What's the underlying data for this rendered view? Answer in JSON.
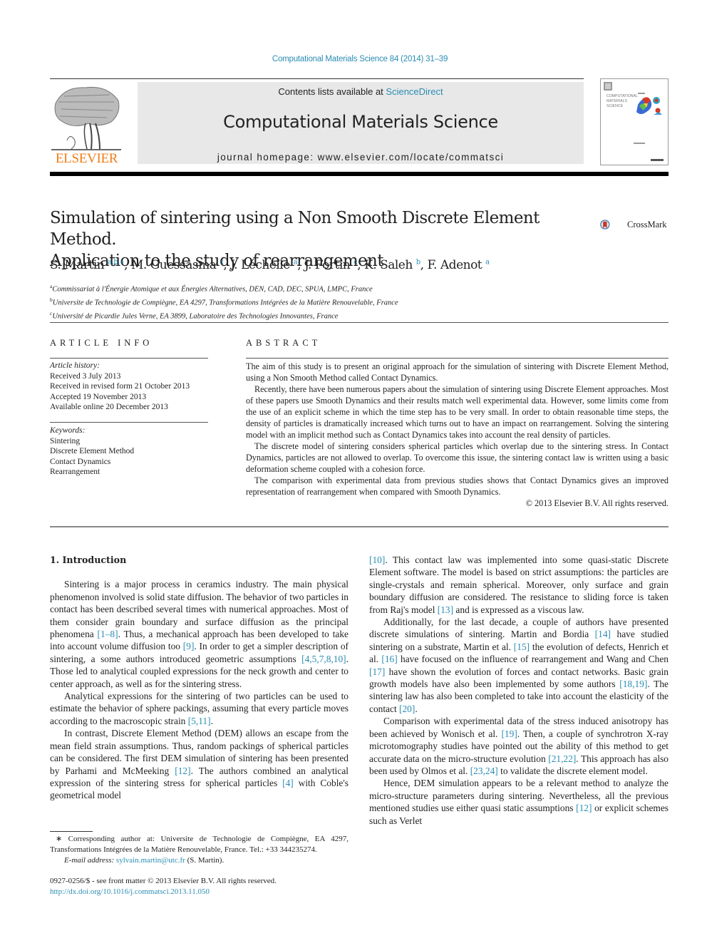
{
  "running_head": "Computational Materials Science 84 (2014) 31–39",
  "publisher": {
    "name": "ELSEVIER",
    "contents_prefix": "Contents lists available at ",
    "contents_link": "ScienceDirect",
    "journal_title": "Computational Materials Science",
    "homepage": "journal homepage: www.elsevier.com/locate/commatsci",
    "cover_text": "COMPUTATIONAL MATERIALS SCIENCE"
  },
  "colors": {
    "link": "#2b8db3",
    "elsevier_orange": "#f07d17"
  },
  "article": {
    "title_line1": "Simulation of sintering using a Non Smooth Discrete Element Method.",
    "title_line2": "Application to the study of rearrangement",
    "crossmark": "CrossMark",
    "authors": [
      {
        "name": "S. Martin",
        "sup": "a,b,∗"
      },
      {
        "name": "M. Guessasma",
        "sup": "c"
      },
      {
        "name": "J. Léchelle",
        "sup": "a"
      },
      {
        "name": "J. Fortin",
        "sup": "c"
      },
      {
        "name": "K. Saleh",
        "sup": "b"
      },
      {
        "name": "F. Adenot",
        "sup": "a"
      }
    ],
    "affiliations": [
      {
        "key": "a",
        "text": "Commissariat à l'Énergie Atomique et aux Énergies Alternatives, DEN, CAD, DEC, SPUA, LMPC, France"
      },
      {
        "key": "b",
        "text": "Universite de Technologie de Compiègne, EA 4297, Transformations Intégrées de la Matière Renouvelable, France"
      },
      {
        "key": "c",
        "text": "Université de Picardie Jules Verne, EA 3899, Laboratoire des Technologies Innovantes, France"
      }
    ]
  },
  "article_info": {
    "heading": "ARTICLE INFO",
    "history_label": "Article history:",
    "history": [
      "Received 3 July 2013",
      "Received in revised form 21 October 2013",
      "Accepted 19 November 2013",
      "Available online 20 December 2013"
    ],
    "keywords_label": "Keywords:",
    "keywords": [
      "Sintering",
      "Discrete Element Method",
      "Contact Dynamics",
      "Rearrangement"
    ]
  },
  "abstract": {
    "heading": "ABSTRACT",
    "paragraphs": [
      "The aim of this study is to present an original approach for the simulation of sintering with Discrete Element Method, using a Non Smooth Method called Contact Dynamics.",
      "Recently, there have been numerous papers about the simulation of sintering using Discrete Element approaches. Most of these papers use Smooth Dynamics and their results match well experimental data. However, some limits come from the use of an explicit scheme in which the time step has to be very small. In order to obtain reasonable time steps, the density of particles is dramatically increased which turns out to have an impact on rearrangement. Solving the sintering model with an implicit method such as Contact Dynamics takes into account the real density of particles.",
      "The discrete model of sintering considers spherical particles which overlap due to the sintering stress. In Contact Dynamics, particles are not allowed to overlap. To overcome this issue, the sintering contact law is written using a basic deformation scheme coupled with a cohesion force.",
      "The comparison with experimental data from previous studies shows that Contact Dynamics gives an improved representation of rearrangement when compared with Smooth Dynamics."
    ],
    "copyright": "© 2013 Elsevier B.V. All rights reserved."
  },
  "body": {
    "section_heading": "1. Introduction",
    "left_paragraphs": [
      [
        {
          "t": "Sintering is a major process in ceramics industry. The main physical phenomenon involved is solid state diffusion. The behavior of two particles in contact has been described several times with numerical approaches. Most of them consider grain boundary and surface diffusion as the principal phenomena "
        },
        {
          "ref": "[1–8]"
        },
        {
          "t": ". Thus, a mechanical approach has been developed to take into account volume diffusion too "
        },
        {
          "ref": "[9]"
        },
        {
          "t": ". In order to get a simpler description of sintering, a some authors introduced geometric assumptions "
        },
        {
          "ref": "[4,5,7,8,10]"
        },
        {
          "t": ". Those led to analytical coupled expressions for the neck growth and center to center approach, as well as for the sintering stress."
        }
      ],
      [
        {
          "t": "Analytical expressions for the sintering of two particles can be used to estimate the behavior of sphere packings, assuming that every particle moves according to the macroscopic strain "
        },
        {
          "ref": "[5,11]"
        },
        {
          "t": "."
        }
      ],
      [
        {
          "t": "In contrast, Discrete Element Method (DEM) allows an escape from the mean field strain assumptions. Thus, random packings of spherical particles can be considered. The first DEM simulation of sintering has been presented by Parhami and McMeeking "
        },
        {
          "ref": "[12]"
        },
        {
          "t": ". The authors combined an analytical expression of the sintering stress for spherical particles "
        },
        {
          "ref": "[4]"
        },
        {
          "t": " with Coble's geometrical model"
        }
      ]
    ],
    "right_paragraphs": [
      [
        {
          "ref": "[10]"
        },
        {
          "t": ". This contact law was implemented into some quasi-static Discrete Element software. The model is based on strict assumptions: the particles are single-crystals and remain spherical. Moreover, only surface and grain boundary diffusion are considered. The resistance to sliding force is taken from Raj's model "
        },
        {
          "ref": "[13]"
        },
        {
          "t": " and is expressed as a viscous law."
        }
      ],
      [
        {
          "t": "Additionally, for the last decade, a couple of authors have presented discrete simulations of sintering. Martin and Bordia "
        },
        {
          "ref": "[14]"
        },
        {
          "t": " have studied sintering on a substrate, Martin et al. "
        },
        {
          "ref": "[15]"
        },
        {
          "t": " the evolution of defects, Henrich et al. "
        },
        {
          "ref": "[16]"
        },
        {
          "t": " have focused on the influence of rearrangement and Wang and Chen "
        },
        {
          "ref": "[17]"
        },
        {
          "t": " have shown the evolution of forces and contact networks. Basic grain growth models have also been implemented by some authors "
        },
        {
          "ref": "[18,19]"
        },
        {
          "t": ". The sintering law has also been completed to take into account the elasticity of the contact "
        },
        {
          "ref": "[20]"
        },
        {
          "t": "."
        }
      ],
      [
        {
          "t": "Comparison with experimental data of the stress induced anisotropy has been achieved by Wonisch et al. "
        },
        {
          "ref": "[19]"
        },
        {
          "t": ". Then, a couple of synchrotron X-ray microtomography studies have pointed out the ability of this method to get accurate data on the micro-structure evolution "
        },
        {
          "ref": "[21,22]"
        },
        {
          "t": ". This approach has also been used by Olmos et al. "
        },
        {
          "ref": "[23,24]"
        },
        {
          "t": " to validate the discrete element model."
        }
      ],
      [
        {
          "t": "Hence, DEM simulation appears to be a relevant method to analyze the micro-structure parameters during sintering. Nevertheless, all the previous mentioned studies use either quasi static assumptions "
        },
        {
          "ref": "[12]"
        },
        {
          "t": " or explicit schemes such as Verlet"
        }
      ]
    ]
  },
  "footnote": {
    "marker": "∗",
    "text": " Corresponding author at: Universite de Technologie de Compiègne, EA 4297, Transformations Intégrées de la Matière Renouvelable, France. Tel.: +33 344235274.",
    "email_label": "E-mail address: ",
    "email": "sylvain.martin@utc.fr",
    "email_suffix": " (S. Martin)."
  },
  "issn_line": "0927-0256/$ - see front matter © 2013 Elsevier B.V. All rights reserved.",
  "doi": "http://dx.doi.org/10.1016/j.commatsci.2013.11.050"
}
